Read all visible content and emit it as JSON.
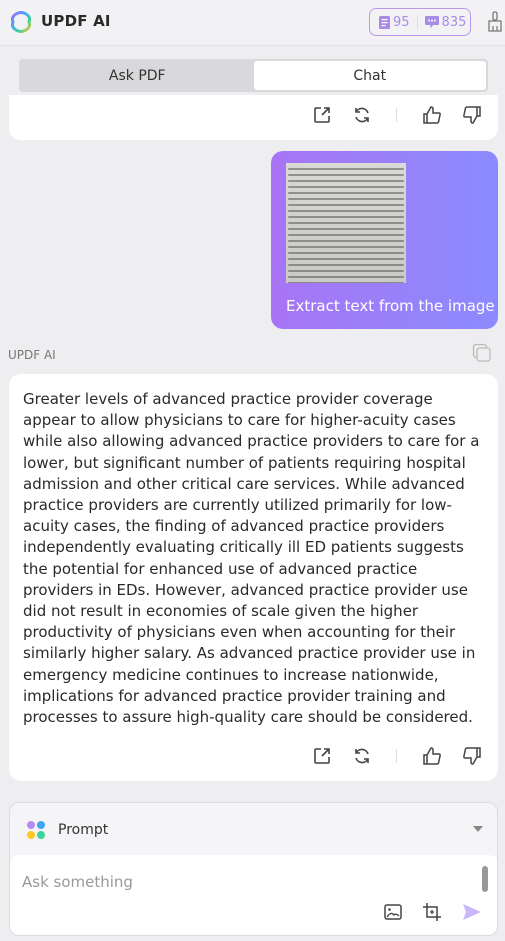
{
  "header": {
    "title": "UPDF AI",
    "quota_docs": "95",
    "quota_chats": "835",
    "icons": {
      "logo": "updf-logo-icon",
      "doc": "document-icon",
      "chat": "chat-bubble-icon",
      "clear": "broom-icon"
    }
  },
  "tabs": [
    {
      "label": "Ask PDF",
      "active": false
    },
    {
      "label": "Chat",
      "active": true
    }
  ],
  "prev_actions": [
    "share-icon",
    "regenerate-icon",
    "thumbs-up-icon",
    "thumbs-down-icon"
  ],
  "user_message": {
    "text": "Extract text from the image",
    "attachment": "scanned-text-image"
  },
  "ai_message": {
    "sender": "UPDF AI",
    "text": "Greater levels of advanced practice provider coverage appear to allow physicians to care for higher-acuity cases while also allowing advanced practice providers to care for a lower, but significant number of patients requiring hospital admission and other critical care services. While advanced practice providers are currently utilized primarily for low-acuity cases, the finding of advanced practice providers independently evaluating critically ill ED patients suggests the potential for enhanced use of advanced practice providers in EDs. However, advanced practice provider use did not result in economies of scale given the higher productivity of physicians even when accounting for their similarly higher salary. As advanced practice provider use in emergency medicine continues to increase nationwide, implications for advanced practice provider training and processes to assure high-quality care should be considered."
  },
  "composer": {
    "prompt_label": "Prompt",
    "placeholder": "Ask something",
    "value": ""
  },
  "colors": {
    "accent": "#a98be8",
    "bubble_start": "#a874f5",
    "bubble_end": "#8b8bfd",
    "send": "#c9b5f7"
  }
}
